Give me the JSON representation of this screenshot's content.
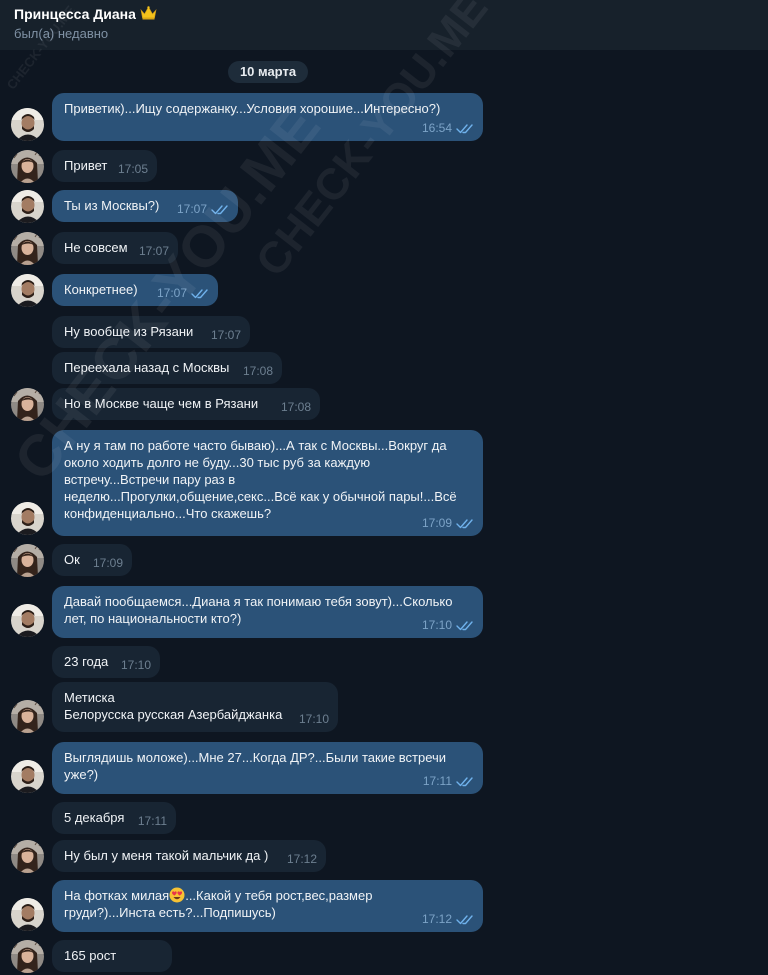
{
  "header": {
    "title": "Принцесса Диана",
    "title_icon": "crown-emoji",
    "status": "был(а) недавно"
  },
  "date_separator": "10 марта",
  "watermark": "CHECK-YOU.ME",
  "colors": {
    "outgoing_bubble": "#2b5278",
    "incoming_bubble": "#182533",
    "background": "#0e1621",
    "read_ticks": "#6fb1eb"
  },
  "messages": [
    {
      "direction": "out",
      "text": "Приветик)...Ищу содержанку...Условия хорошие...Интересно?)",
      "time": "16:54",
      "read": true
    },
    {
      "direction": "in",
      "text": "Привет",
      "time": "17:05"
    },
    {
      "direction": "out",
      "text": "Ты из Москвы?)",
      "time": "17:07",
      "read": true
    },
    {
      "direction": "in",
      "text": "Не совсем",
      "time": "17:07"
    },
    {
      "direction": "out",
      "text": "Конкретнее)",
      "time": "17:07",
      "read": true
    },
    {
      "direction": "in",
      "text": "Ну вообще из Рязани",
      "time": "17:07"
    },
    {
      "direction": "in",
      "text": "Переехала назад с Москвы",
      "time": "17:08"
    },
    {
      "direction": "in",
      "text": "Но в Москве чаще чем в Рязани",
      "time": "17:08"
    },
    {
      "direction": "out",
      "text": "А ну я там по работе часто бываю)...А так с Москвы...Вокруг да\nоколо ходить долго не буду...30 тыс руб за каждую\nвстречу...Встречи пару раз в\nнеделю...Прогулки,общение,секс...Всё как у обычной пары!...Всё\nконфиденциально...Что скажешь?",
      "time": "17:09",
      "read": true
    },
    {
      "direction": "in",
      "text": "Ок",
      "time": "17:09"
    },
    {
      "direction": "out",
      "text": "Давай пообщаемся...Диана я так понимаю тебя зовут)...Сколько\nлет, по национальности кто?)",
      "time": "17:10",
      "read": true
    },
    {
      "direction": "in",
      "text": "23 года",
      "time": "17:10"
    },
    {
      "direction": "in",
      "text": "Метиска\nБелорусска русская Азербайджанка",
      "time": "17:10"
    },
    {
      "direction": "out",
      "text": "Выглядишь моложе)...Мне 27...Когда ДР?...Были такие встречи\nуже?)",
      "time": "17:11",
      "read": true
    },
    {
      "direction": "in",
      "text": "5 декабря",
      "time": "17:11"
    },
    {
      "direction": "in",
      "text": "Ну был у меня такой мальчик да )",
      "time": "17:12"
    },
    {
      "direction": "out",
      "text_before_emoji": "На фотках милая",
      "emoji": "heart-eyes-emoji",
      "text_after_emoji": "...Какой у тебя рост,вес,размер\nгруди?)...Инста есть?...Подпишусь)",
      "time": "17:12",
      "read": true
    },
    {
      "direction": "in",
      "text": "165 рост",
      "time": ""
    }
  ]
}
